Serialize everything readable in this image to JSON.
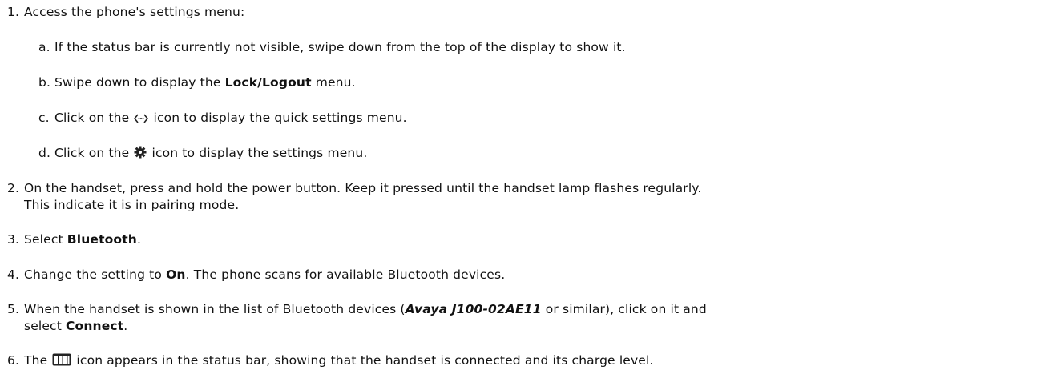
{
  "steps": [
    {
      "num": "1.",
      "text": "Access the phone's settings menu:",
      "sub": [
        {
          "letter": "a.",
          "text": "If the status bar is currently not visible, swipe down from the top of the display to show it."
        },
        {
          "letter": "b.",
          "pre": "Swipe down to display the ",
          "bold": "Lock/Logout",
          "post": " menu."
        },
        {
          "letter": "c.",
          "pre": "Click on the ",
          "icon": "quick-settings-icon",
          "post": " icon to display the quick settings menu."
        },
        {
          "letter": "d.",
          "pre": "Click on the ",
          "icon": "gear-icon",
          "post": " icon to display the settings menu."
        }
      ]
    },
    {
      "num": "2.",
      "line1": "On the handset, press and hold the power button. Keep it pressed until the handset lamp flashes regularly.",
      "line2": "This indicate it is in pairing mode."
    },
    {
      "num": "3.",
      "pre": "Select ",
      "bold": "Bluetooth",
      "post": "."
    },
    {
      "num": "4.",
      "pre": "Change the setting to ",
      "bold": "On",
      "post": ". The phone scans for available Bluetooth devices."
    },
    {
      "num": "5.",
      "pre": "When the handset is shown in the list of Bluetooth devices (",
      "bold_italic": "Avaya J100-02AE11",
      "post": " or similar), click on it and",
      "line2_pre": "select ",
      "line2_bold": "Connect",
      "line2_post": "."
    },
    {
      "num": "6.",
      "pre": "The ",
      "icon": "battery-icon",
      "post": " icon appears in the status bar, showing that the handset is connected and its charge level."
    }
  ]
}
